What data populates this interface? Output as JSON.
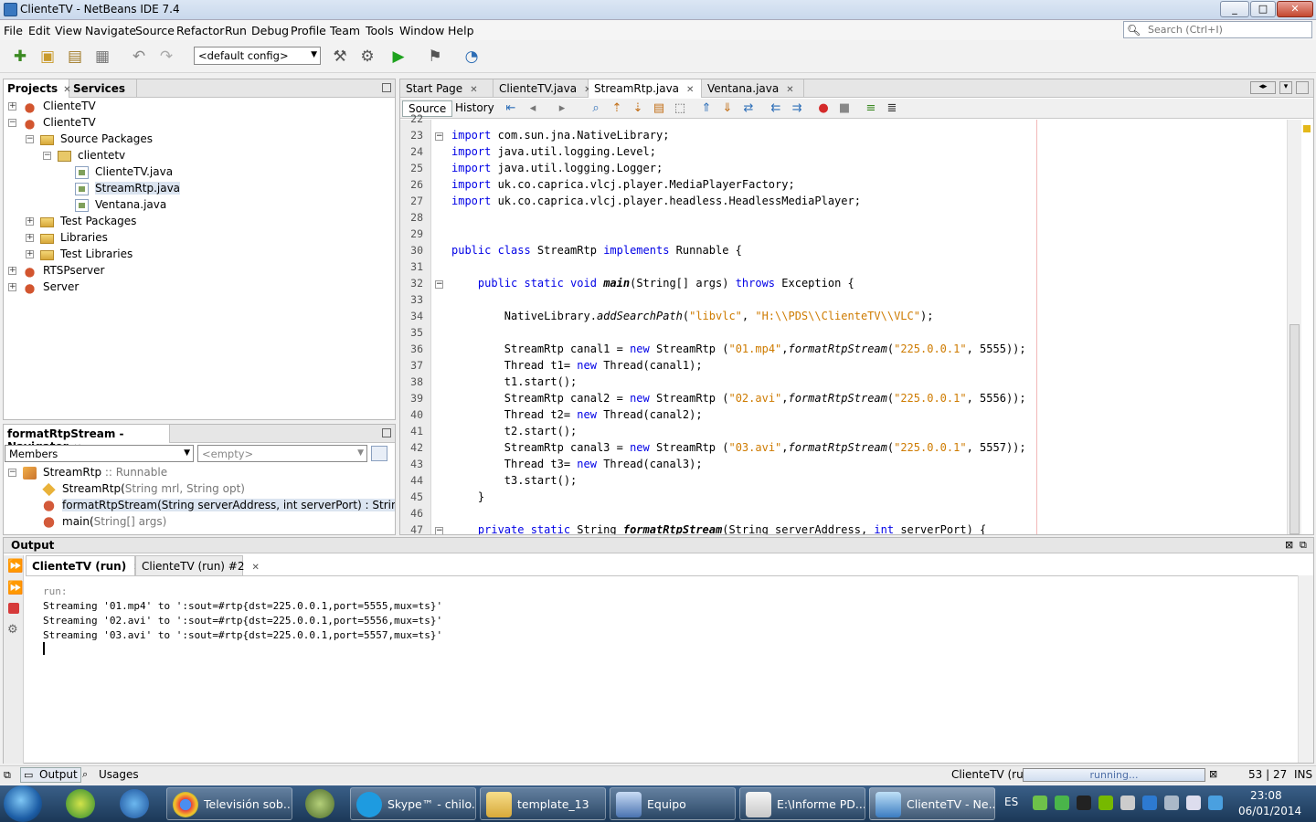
{
  "window": {
    "title": "ClienteTV - NetBeans IDE 7.4",
    "controls": [
      "_",
      "□",
      "✕"
    ]
  },
  "menu": [
    "File",
    "Edit",
    "View",
    "Navigate",
    "Source",
    "Refactor",
    "Run",
    "Debug",
    "Profile",
    "Team",
    "Tools",
    "Window",
    "Help"
  ],
  "search": {
    "placeholder": "Search (Ctrl+I)"
  },
  "toolbar": {
    "config": "<default config>"
  },
  "projects": {
    "tabs": [
      "Projects",
      "Services"
    ],
    "tree": [
      {
        "label": "ClienteTV",
        "icon": "coffee",
        "depth": 0,
        "exp": "+"
      },
      {
        "label": "ClienteTV",
        "icon": "coffee",
        "depth": 0,
        "exp": "−"
      },
      {
        "label": "Source Packages",
        "icon": "folder",
        "depth": 1,
        "exp": "−"
      },
      {
        "label": "clientetv",
        "icon": "pkg",
        "depth": 2,
        "exp": "−"
      },
      {
        "label": "ClienteTV.java",
        "icon": "java",
        "depth": 3,
        "exp": ""
      },
      {
        "label": "StreamRtp.java",
        "icon": "java",
        "depth": 3,
        "exp": "",
        "selected": true
      },
      {
        "label": "Ventana.java",
        "icon": "java",
        "depth": 3,
        "exp": ""
      },
      {
        "label": "Test Packages",
        "icon": "folder",
        "depth": 1,
        "exp": "+"
      },
      {
        "label": "Libraries",
        "icon": "folder",
        "depth": 1,
        "exp": "+"
      },
      {
        "label": "Test Libraries",
        "icon": "folder",
        "depth": 1,
        "exp": "+"
      },
      {
        "label": "RTSPserver",
        "icon": "coffee",
        "depth": 0,
        "exp": "+"
      },
      {
        "label": "Server",
        "icon": "coffee",
        "depth": 0,
        "exp": "+"
      }
    ]
  },
  "navigator": {
    "title": "formatRtpStream - Navigator",
    "filter": "Members",
    "empty": "<empty>",
    "items": [
      {
        "main": "StreamRtp",
        "sub": " :: Runnable",
        "depth": 0
      },
      {
        "main": "StreamRtp(",
        "sub": "String mrl, String opt)",
        "depth": 1
      },
      {
        "main": "formatRtpStream(String serverAddress, int serverPort) : String",
        "sub": "",
        "depth": 1,
        "selected": true
      },
      {
        "main": "main(",
        "sub": "String[] args)",
        "depth": 1
      }
    ]
  },
  "editor": {
    "tabs": [
      {
        "label": "Start Page",
        "active": false
      },
      {
        "label": "ClienteTV.java",
        "active": false
      },
      {
        "label": "StreamRtp.java",
        "active": true
      },
      {
        "label": "Ventana.java",
        "active": false
      }
    ],
    "modes": [
      "Source",
      "History"
    ],
    "lines": [
      {
        "n": "22",
        "html": ""
      },
      {
        "n": "23",
        "html": "<span class=\"kw\">import</span> com.sun.jna.NativeLibrary;"
      },
      {
        "n": "24",
        "html": "<span class=\"kw\">import</span> java.util.logging.Level;"
      },
      {
        "n": "25",
        "html": "<span class=\"kw\">import</span> java.util.logging.Logger;"
      },
      {
        "n": "26",
        "html": "<span class=\"kw\">import</span> uk.co.caprica.vlcj.player.MediaPlayerFactory;"
      },
      {
        "n": "27",
        "html": "<span class=\"kw\">import</span> uk.co.caprica.vlcj.player.headless.HeadlessMediaPlayer;"
      },
      {
        "n": "28",
        "html": ""
      },
      {
        "n": "29",
        "html": ""
      },
      {
        "n": "30",
        "html": "<span class=\"kw\">public class</span> StreamRtp <span class=\"kw\">implements</span> Runnable {"
      },
      {
        "n": "31",
        "html": ""
      },
      {
        "n": "32",
        "html": "    <span class=\"kw\">public static void</span> <b class=\"it\">main</b>(String[] args) <span class=\"kw\">throws</span> Exception {"
      },
      {
        "n": "33",
        "html": ""
      },
      {
        "n": "34",
        "html": "        NativeLibrary.<span class=\"it\">addSearchPath</span>(<span class=\"str\">\"libvlc\"</span>, <span class=\"str\">\"H:\\\\PDS\\\\ClienteTV\\\\VLC\"</span>);"
      },
      {
        "n": "35",
        "html": ""
      },
      {
        "n": "36",
        "html": "        StreamRtp canal1 = <span class=\"kw\">new</span> StreamRtp (<span class=\"str\">\"01.mp4\"</span>,<span class=\"it\">formatRtpStream</span>(<span class=\"str\">\"225.0.0.1\"</span>, 5555));"
      },
      {
        "n": "37",
        "html": "        Thread t1= <span class=\"kw\">new</span> Thread(canal1);"
      },
      {
        "n": "38",
        "html": "        t1.start();"
      },
      {
        "n": "39",
        "html": "        StreamRtp canal2 = <span class=\"kw\">new</span> StreamRtp (<span class=\"str\">\"02.avi\"</span>,<span class=\"it\">formatRtpStream</span>(<span class=\"str\">\"225.0.0.1\"</span>, 5556));"
      },
      {
        "n": "40",
        "html": "        Thread t2= <span class=\"kw\">new</span> Thread(canal2);"
      },
      {
        "n": "41",
        "html": "        t2.start();"
      },
      {
        "n": "42",
        "html": "        StreamRtp canal3 = <span class=\"kw\">new</span> StreamRtp (<span class=\"str\">\"03.avi\"</span>,<span class=\"it\">formatRtpStream</span>(<span class=\"str\">\"225.0.0.1\"</span>, 5557));"
      },
      {
        "n": "43",
        "html": "        Thread t3= <span class=\"kw\">new</span> Thread(canal3);"
      },
      {
        "n": "44",
        "html": "        t3.start();"
      },
      {
        "n": "45",
        "html": "    }"
      },
      {
        "n": "46",
        "html": ""
      },
      {
        "n": "47",
        "html": "    <span class=\"kw\">private static</span> String <b class=\"it\">formatRtpStream</b>(String serverAddress, <span class=\"kw\">int</span> serverPort) {"
      }
    ]
  },
  "output": {
    "title": "Output",
    "tabs": [
      {
        "label": "ClienteTV (run)",
        "active": true
      },
      {
        "label": "ClienteTV (run) #2",
        "active": false
      }
    ],
    "lines": [
      "run:",
      "Streaming '01.mp4' to ':sout=#rtp{dst=225.0.0.1,port=5555,mux=ts}'",
      "Streaming '02.avi' to ':sout=#rtp{dst=225.0.0.1,port=5556,mux=ts}'",
      "Streaming '03.avi' to ':sout=#rtp{dst=225.0.0.1,port=5557,mux=ts}'"
    ]
  },
  "status": {
    "left_tabs": [
      "Output",
      "Usages"
    ],
    "task": "ClienteTV (run)",
    "progress_text": "running...",
    "position": "53 | 27",
    "mode": "INS"
  },
  "taskbar": {
    "items": [
      "Televisión sob...",
      "Skype™ - chilo...",
      "template_13",
      "Equipo",
      "E:\\Informe PD...",
      "ClienteTV - Ne..."
    ],
    "lang": "ES",
    "time": "23:08",
    "date": "06/01/2014"
  }
}
